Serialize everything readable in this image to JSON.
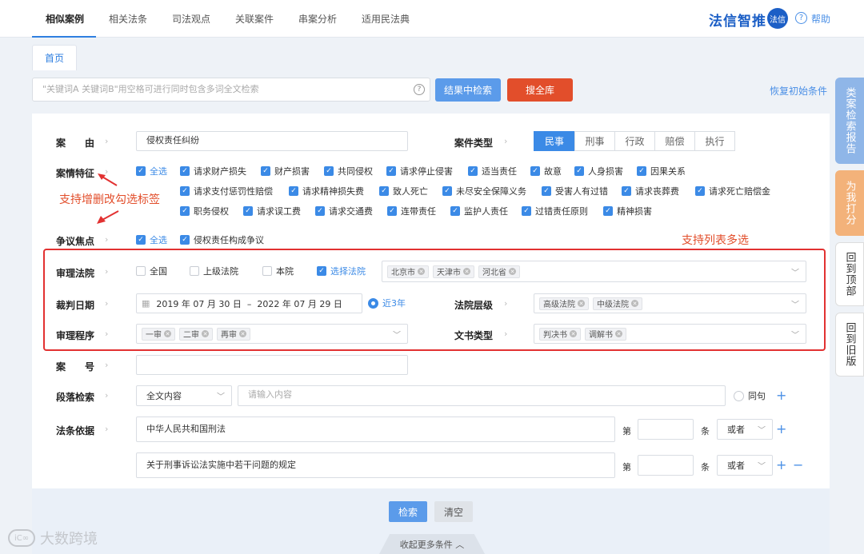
{
  "nav": {
    "tabs": [
      "相似案例",
      "相关法条",
      "司法观点",
      "关联案件",
      "串案分析",
      "适用民法典"
    ],
    "active": 0
  },
  "brand": {
    "name": "法信智推",
    "logo": "法信",
    "help": "帮助"
  },
  "home_tab": "首页",
  "search": {
    "placeholder": "\"关键词A 关键词B\"用空格可进行同时包含多词全文检索",
    "btn_within": "结果中检索",
    "btn_all": "搜全库",
    "restore": "恢复初始条件"
  },
  "case_reason": {
    "label": "案　　由",
    "value": "侵权责任纠纷"
  },
  "case_type": {
    "label": "案件类型",
    "options": [
      "民事",
      "刑事",
      "行政",
      "赔偿",
      "执行"
    ],
    "active": 0
  },
  "features": {
    "label": "案情特征",
    "rows": [
      [
        "全选",
        "请求财产损失",
        "财产损害",
        "共同侵权",
        "请求停止侵害",
        "适当责任",
        "故意",
        "人身损害",
        "因果关系"
      ],
      [
        "请求支付惩罚性赔偿",
        "请求精神损失费",
        "致人死亡",
        "未尽安全保障义务",
        "受害人有过错",
        "请求丧葬费",
        "请求死亡赔偿金"
      ],
      [
        "职务侵权",
        "请求误工费",
        "请求交通费",
        "连带责任",
        "监护人责任",
        "过错责任原则",
        "精神损害"
      ]
    ]
  },
  "annotation1": "支持增删改勾选标签",
  "annotation2": "支持列表多选",
  "dispute": {
    "label": "争议焦点",
    "items": [
      "全选",
      "侵权责任构成争议"
    ]
  },
  "court": {
    "label": "审理法院",
    "options": [
      "全国",
      "上级法院",
      "本院",
      "选择法院"
    ],
    "tags": [
      "北京市",
      "天津市",
      "河北省"
    ]
  },
  "date": {
    "label": "裁判日期",
    "range": "2019 年 07 月 30 日  –  2022 年 07 月 29 日",
    "recent": "近3年"
  },
  "court_level": {
    "label": "法院层级",
    "tags": [
      "高级法院",
      "中级法院"
    ]
  },
  "procedure": {
    "label": "审理程序",
    "tags": [
      "一审",
      "二审",
      "再审"
    ]
  },
  "doc_type": {
    "label": "文书类型",
    "tags": [
      "判决书",
      "调解书"
    ]
  },
  "case_no": {
    "label": "案　　号",
    "value": ""
  },
  "paragraph": {
    "label": "段落检索",
    "scope": "全文内容",
    "placeholder": "请输入内容",
    "same_sentence": "同句"
  },
  "law": {
    "label": "法条依据",
    "rows": [
      {
        "name": "中华人民共和国刑法",
        "di": "第",
        "tiao": "条",
        "op": "或者"
      },
      {
        "name": "关于刑事诉讼法实施中若干问题的规定",
        "di": "第",
        "tiao": "条",
        "op": "或者"
      }
    ]
  },
  "actions": {
    "search": "检索",
    "clear": "清空",
    "collapse": "收起更多条件 ︿"
  },
  "side": {
    "report": "类案检索报告",
    "rate": "为我打分",
    "top": "回到顶部",
    "old": "回到旧版"
  },
  "watermark": "大数跨境"
}
